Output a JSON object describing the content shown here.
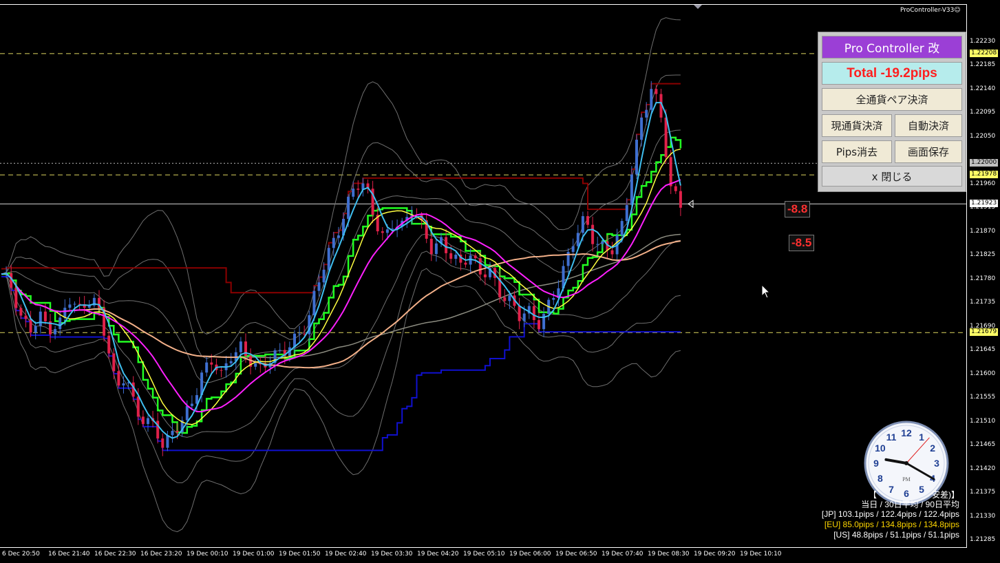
{
  "indicator_name": "ProController-V33☺",
  "price_axis": {
    "ticks": [
      "1.22230",
      "1.22185",
      "1.22140",
      "1.22095",
      "1.22050",
      "1.21960",
      "1.21915",
      "1.21870",
      "1.21825",
      "1.21780",
      "1.21735",
      "1.21690",
      "1.21645",
      "1.21600",
      "1.21555",
      "1.21510",
      "1.21465",
      "1.21420",
      "1.21375",
      "1.21330",
      "1.21285"
    ],
    "ylim": [
      1.2128,
      1.2226
    ],
    "level_tags": [
      {
        "value": "1.22208",
        "color": "#ffff66"
      },
      {
        "value": "1.22000",
        "color": "#c0c0c0"
      },
      {
        "value": "1.21978",
        "color": "#ffff66"
      },
      {
        "value": "1.21923",
        "color": "#ffffff"
      },
      {
        "value": "1.21679",
        "color": "#ffff66"
      }
    ]
  },
  "time_axis": {
    "labels": [
      "6 Dec 20:50",
      "16 Dec 21:40",
      "16 Dec 22:30",
      "16 Dec 23:20",
      "19 Dec 00:10",
      "19 Dec 01:00",
      "19 Dec 01:50",
      "19 Dec 02:40",
      "19 Dec 03:30",
      "19 Dec 04:20",
      "19 Dec 05:10",
      "19 Dec 06:00",
      "19 Dec 06:50",
      "19 Dec 07:40",
      "19 Dec 08:30",
      "19 Dec 09:20",
      "19 Dec 10:10"
    ]
  },
  "panel": {
    "title": "Pro Controller 改",
    "total": "Total   -19.2pips",
    "close_all": "全通貨ペア決済",
    "close_current": "現通貨決済",
    "auto_close": "自動決済",
    "clear_pips": "Pips消去",
    "save_screen": "画面保存",
    "close_panel": "x 閉じる"
  },
  "pip_labels": [
    "-8.8",
    "-8.5"
  ],
  "volatility": {
    "header": "【 　 　 　 　 　 安差)】",
    "subheader": "当日 / 30日平均 / 90日平均",
    "rows": [
      {
        "text": "[JP] 103.1pips / 122.4pips / 122.4pips",
        "color": "#ffffff"
      },
      {
        "text": "[EU] 85.0pips / 134.8pips / 134.8pips",
        "color": "#ffd700"
      },
      {
        "text": "[US] 48.8pips / 51.1pips / 51.1pips",
        "color": "#ffffff"
      }
    ]
  },
  "clock": {
    "hour": 9,
    "minute": 20,
    "second": 7,
    "label": "PM"
  },
  "colors": {
    "bull": "#3f6fd0",
    "bear": "#e0214a",
    "bb_lines": "#6f6f6f",
    "ma_fast": "#3fbff0",
    "ma_yellow": "#ffff40",
    "ma_magenta": "#ff20ff",
    "ma_green": "#22ff22",
    "ma_salmon": "#f3b089",
    "ma_gray": "#8c8c80",
    "darkred": "#8b0000",
    "blue": "#1010d0",
    "level": "#e0d860"
  },
  "chart_data": {
    "type": "candlestick",
    "close_path": [
      1.2179,
      1.2176,
      1.217,
      1.2169,
      1.2172,
      1.2169,
      1.2168,
      1.2174,
      1.2172,
      1.2175,
      1.2174,
      1.2166,
      1.2156,
      1.216,
      1.2154,
      1.2152,
      1.215,
      1.2145,
      1.2149,
      1.2152,
      1.2156,
      1.216,
      1.2162,
      1.2159,
      1.2164,
      1.2166,
      1.2163,
      1.216,
      1.2162,
      1.2164,
      1.2166,
      1.2168,
      1.2169,
      1.2176,
      1.2182,
      1.2187,
      1.2192,
      1.2196,
      1.2195,
      1.2189,
      1.2186,
      1.219,
      1.2188,
      1.2191,
      1.2187,
      1.2184,
      1.2186,
      1.2183,
      1.218,
      1.2182,
      1.2179,
      1.2181,
      1.2176,
      1.2174,
      1.217,
      1.2172,
      1.217,
      1.2173,
      1.2176,
      1.218,
      1.2186,
      1.219,
      1.2186,
      1.2184,
      1.2183,
      1.2188,
      1.22,
      1.221,
      1.2215,
      1.2208,
      1.2194,
      1.21923
    ]
  }
}
